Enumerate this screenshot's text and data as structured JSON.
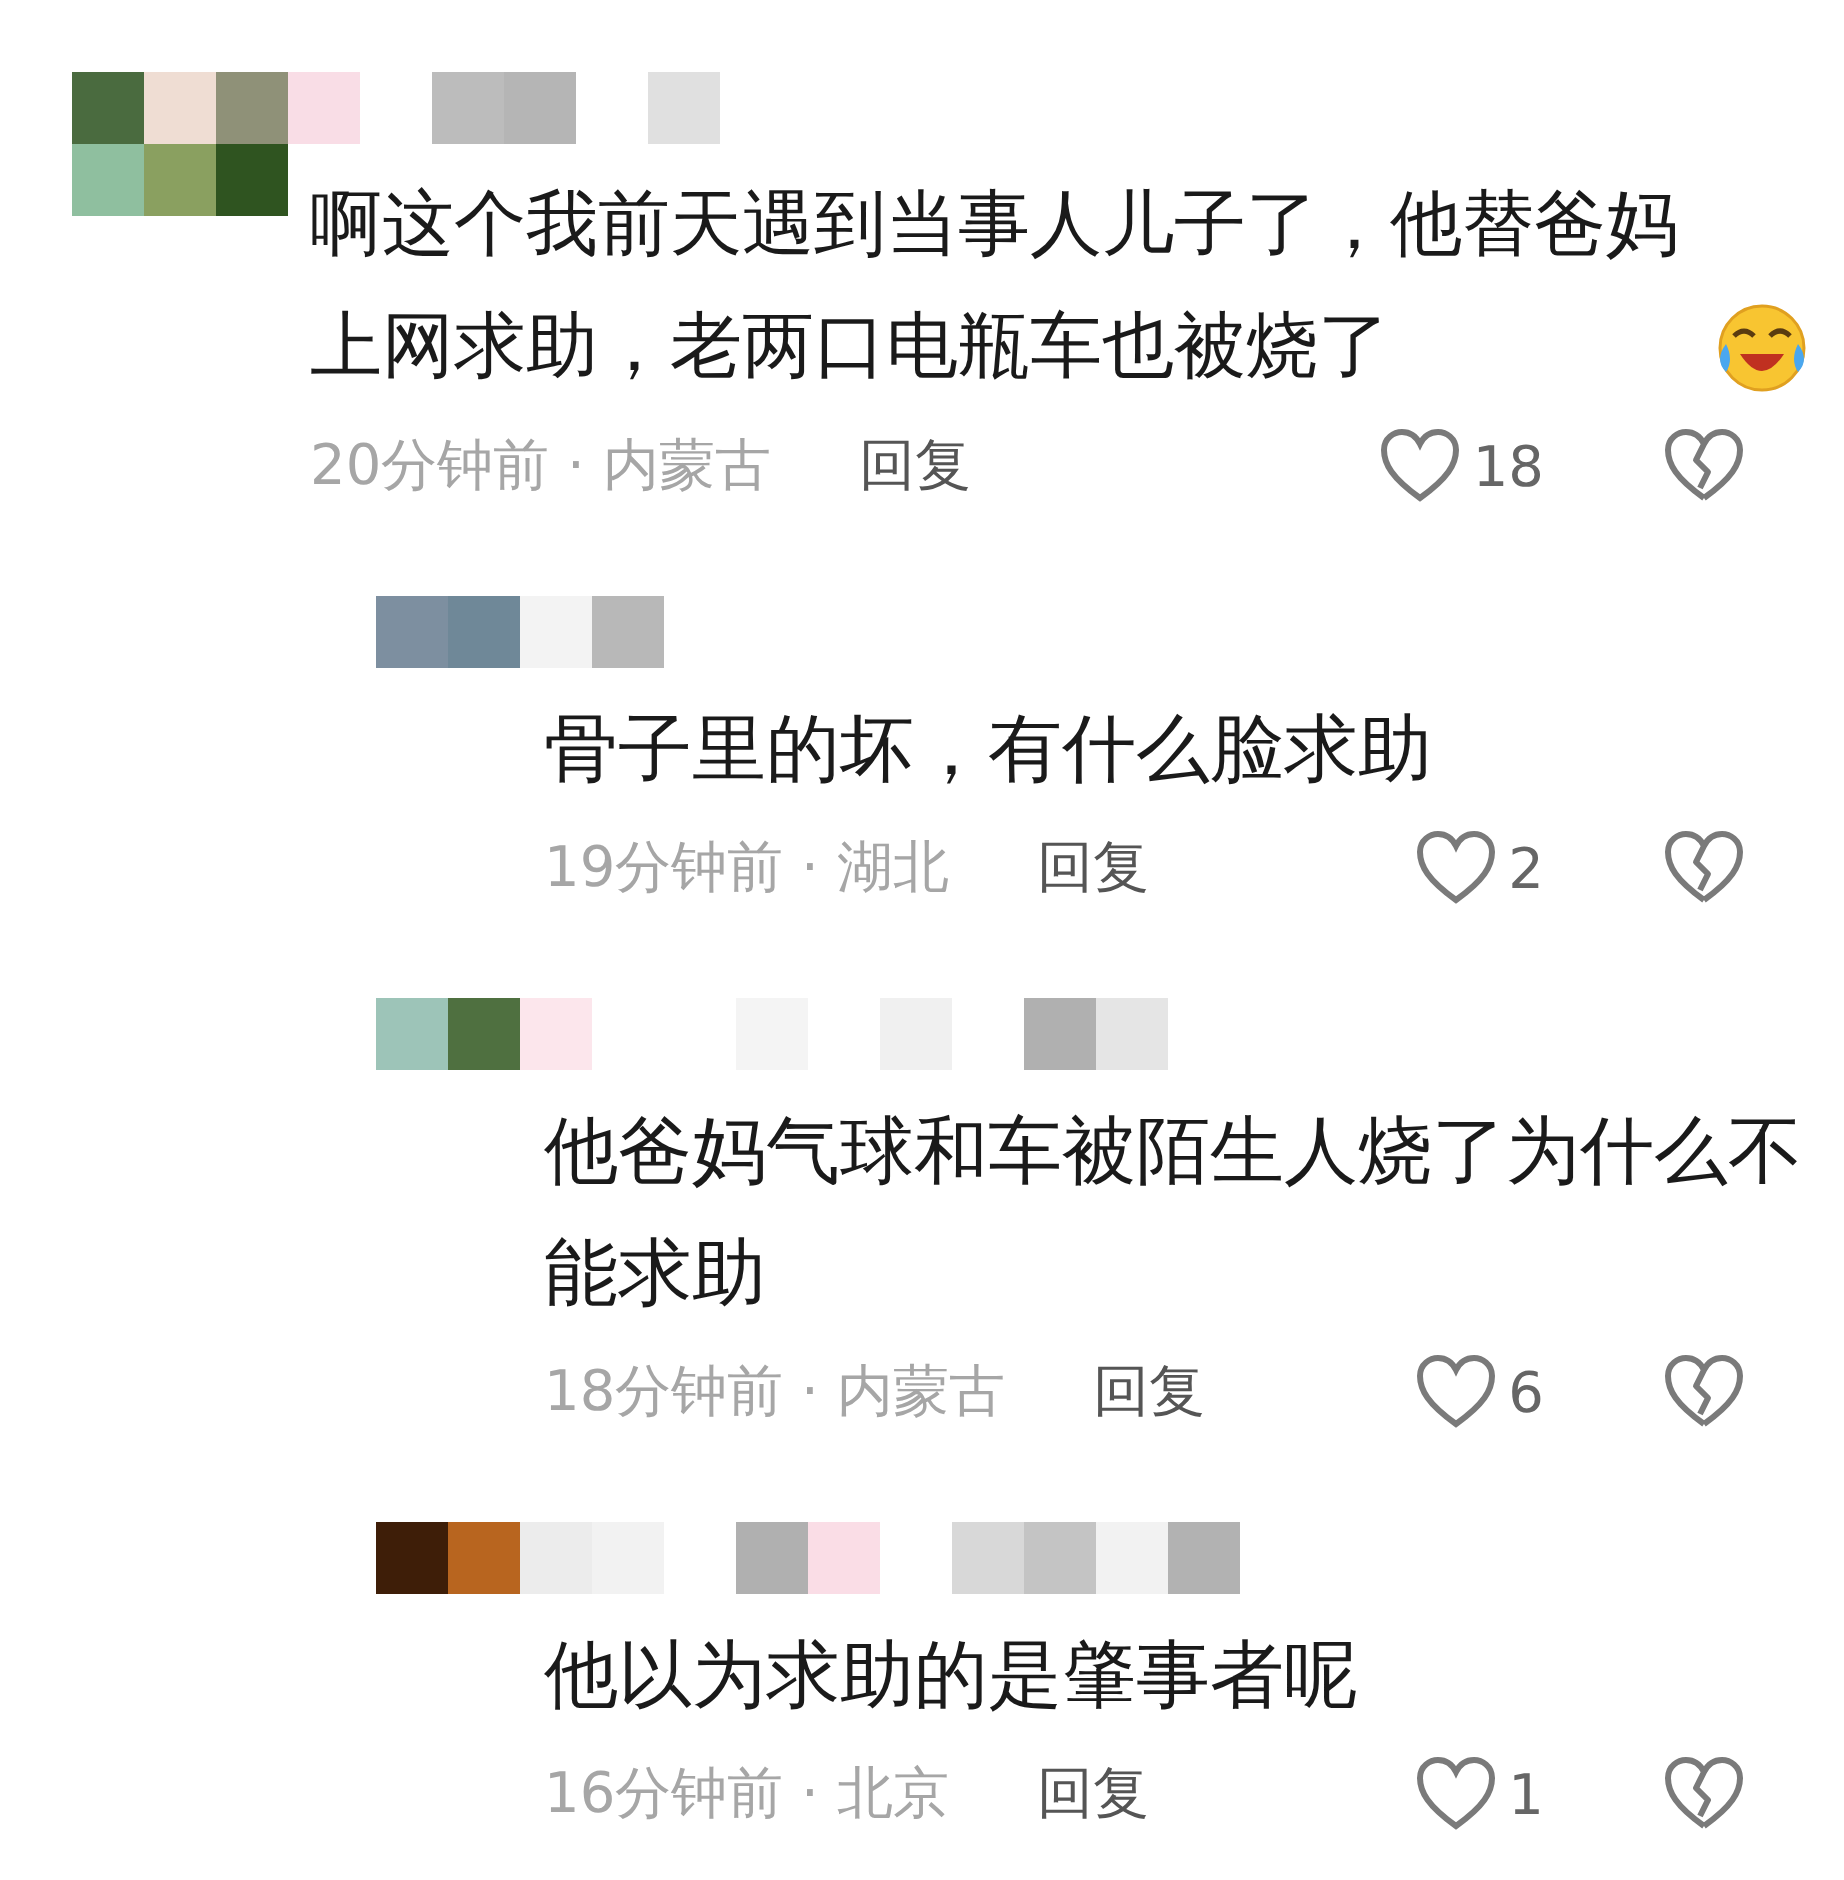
{
  "comments": [
    {
      "kind": "top",
      "text": "啊这个我前天遇到当事人儿子了，他替爸妈上网求助，老两口电瓶车也被烧了",
      "trailing_emoji": true,
      "meta": "20分钟前 · 内蒙古",
      "reply_label": "回复",
      "likes": "18"
    },
    {
      "kind": "reply",
      "text": "骨子里的坏，有什么脸求助",
      "trailing_emoji": false,
      "meta": "19分钟前 · 湖北",
      "reply_label": "回复",
      "likes": "2"
    },
    {
      "kind": "reply",
      "text": "他爸妈气球和车被陌生人烧了为什么不能求助",
      "trailing_emoji": false,
      "meta": "18分钟前 · 内蒙古",
      "reply_label": "回复",
      "likes": "6"
    },
    {
      "kind": "reply",
      "text": "他以为求助的是肇事者呢",
      "trailing_emoji": false,
      "meta": "16分钟前 · 北京",
      "reply_label": "回复",
      "likes": "1"
    }
  ]
}
